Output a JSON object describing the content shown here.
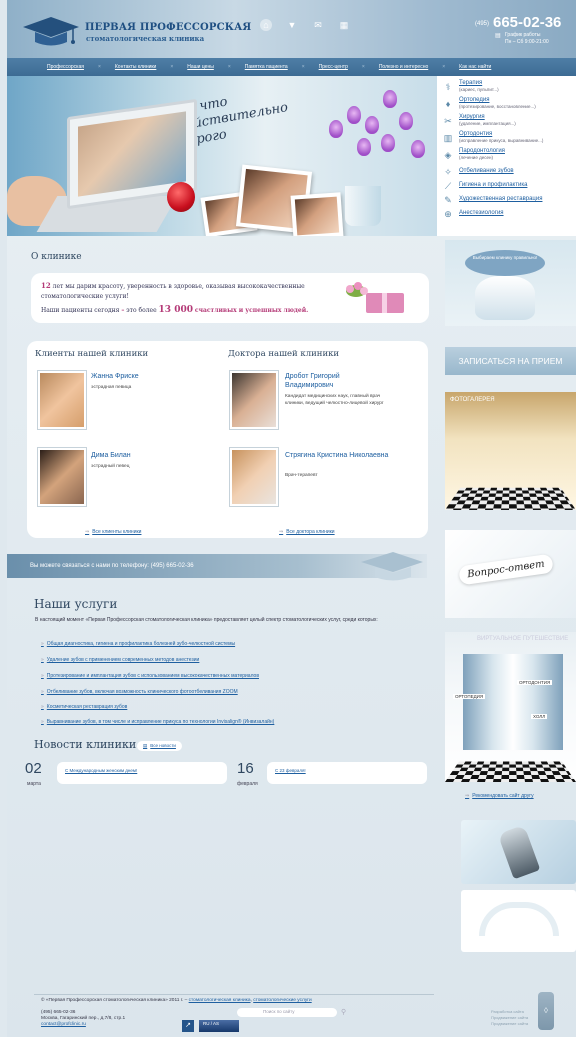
{
  "header": {
    "logo_line1": "ПЕРВАЯ ПРОФЕССОРСКАЯ",
    "logo_line2": "стоматологическая клиника",
    "phone_code": "(495)",
    "phone_number": "665-02-36",
    "schedule_label": "График работы",
    "schedule_hours": "Пн – Сб 9:00-21:00",
    "icons": [
      "home-icon",
      "filter-icon",
      "mail-icon",
      "sitemap-icon"
    ]
  },
  "nav": {
    "items": [
      "Профессорская",
      "Контакты клиники",
      "Наши цены",
      "Памятка пациента",
      "Пресс-центр",
      "Полезно и интересно",
      "Как нас найти"
    ]
  },
  "banner": {
    "tagline": "То, что действительно дорого"
  },
  "services_menu": [
    {
      "title": "Терапия",
      "sub": "(кариес, пульпит...)",
      "icon": "tooth-instrument-icon"
    },
    {
      "title": "Ортопедия",
      "sub": "(протезирование, восстановление...)",
      "icon": "tooth-implant-icon"
    },
    {
      "title": "Хирургия",
      "sub": "(удаление, имплантация...)",
      "icon": "scalpel-icon"
    },
    {
      "title": "Ортодонтия",
      "sub": "(исправление прикуса, выравнивание...)",
      "icon": "braces-icon"
    },
    {
      "title": "Пародонтология",
      "sub": "(лечение десен)",
      "icon": "gums-icon"
    },
    {
      "title": "Отбеливание зубов",
      "sub": "",
      "icon": "tooth-whitening-icon"
    },
    {
      "title": "Гигиена и профилактика",
      "sub": "",
      "icon": "toothbrush-icon"
    },
    {
      "title": "Художественная реставрация",
      "sub": "",
      "icon": "brush-icon"
    },
    {
      "title": "Анестезиология",
      "sub": "",
      "icon": "anesthesia-icon"
    }
  ],
  "about": {
    "title": "О клинике",
    "years": "12",
    "line1_rest": "лет мы дарим красоту, уверенность в здоровье, оказывая высококачественные",
    "line2": "стоматологические услуги!",
    "line3_start": "Наши пациенты сегодня",
    "line3_dash": "–",
    "line3_mid": "это более",
    "count": "13 000",
    "line3_end": "счастливых и успешных людей."
  },
  "clients": {
    "title": "Клиенты нашей клиники",
    "people": [
      {
        "name": "Жанна Фриске",
        "desc": "эстрадная певица"
      },
      {
        "name": "Дима Билан",
        "desc": "эстрадный певец"
      }
    ],
    "all_link": "Все клиенты клиники"
  },
  "doctors": {
    "title": "Доктора нашей клиники",
    "people": [
      {
        "name": "Дробот Григорий Владимирович",
        "desc": "Кандидат медицинских наук, главный врач клиники, ведущий челюстно-лицевой хирург"
      },
      {
        "name": "Стрягина Кристина Николаевна",
        "desc": "Врач-терапевт"
      }
    ],
    "all_link": "Все доктора клиники"
  },
  "contact_band": {
    "text": "Вы можете связаться с нами по телефону: (495) 665-02-36"
  },
  "services": {
    "title": "Наши услуги",
    "intro": "В настоящий момент «Первая Профессорская стоматологическая клиника» предоставляет целый спектр стоматологических услуг, среди которых:",
    "links": [
      "Общая диагностика, гигиена и профилактика болезней зубо-челюстной системы",
      "Удаление зубов с применением современных методов анестезии",
      "Протезирование и имплантация зубов с использованием высококачественных материалов",
      "Отбеливание зубов, включая возможность клинического фотоотбеливания ZOOM",
      "Косметическая реставрация зубов",
      "Выравнивание зубов, в том числе и исправление прикуса по технологии Invisalign® (Инвизалайн)"
    ]
  },
  "news": {
    "title": "Новости клиники",
    "all_label": "Все новости",
    "items": [
      {
        "day": "02",
        "month": "марта",
        "title": "С Международным женским днем!"
      },
      {
        "day": "16",
        "month": "февраля",
        "title": "С 23 февраля!"
      }
    ]
  },
  "sidebar": {
    "promo_bubble": "Выбираем клинику правильно!",
    "appointment_label": "ЗАПИСАТЬСЯ НА ПРИЕМ",
    "gallery_label": "ФОТОГАЛЕРЕЯ",
    "qa_label": "Вопрос-ответ",
    "virtual_tour_label": "ВИРТУАЛЬНОЕ ПУТЕШЕСТВИЕ",
    "tour_signs": [
      "ОРТОПЕДИЯ",
      "ОРТОДОНТИЯ",
      "ХОЛЛ"
    ],
    "recommend_label": "Рекомендовать сайт другу"
  },
  "footer": {
    "copyright_prefix": "© «Первая Профессорская стоматологическая клиника» 2011 г. –",
    "copyright_link1": "стоматологическая клиника",
    "copyright_link2": "стоматологические услуги",
    "phone": "(495) 665-02-36",
    "address": "Москва, Гагаринский пер., д.7/8, стр.1",
    "email": "contact@profclinic.ru",
    "search_placeholder": "Поиск по сайту",
    "badge_text": "RU / AS",
    "dev_line1": "Разработка сайта",
    "dev_line2": "Продвижение сайта",
    "dev_line3": "Продвижение сайта"
  }
}
